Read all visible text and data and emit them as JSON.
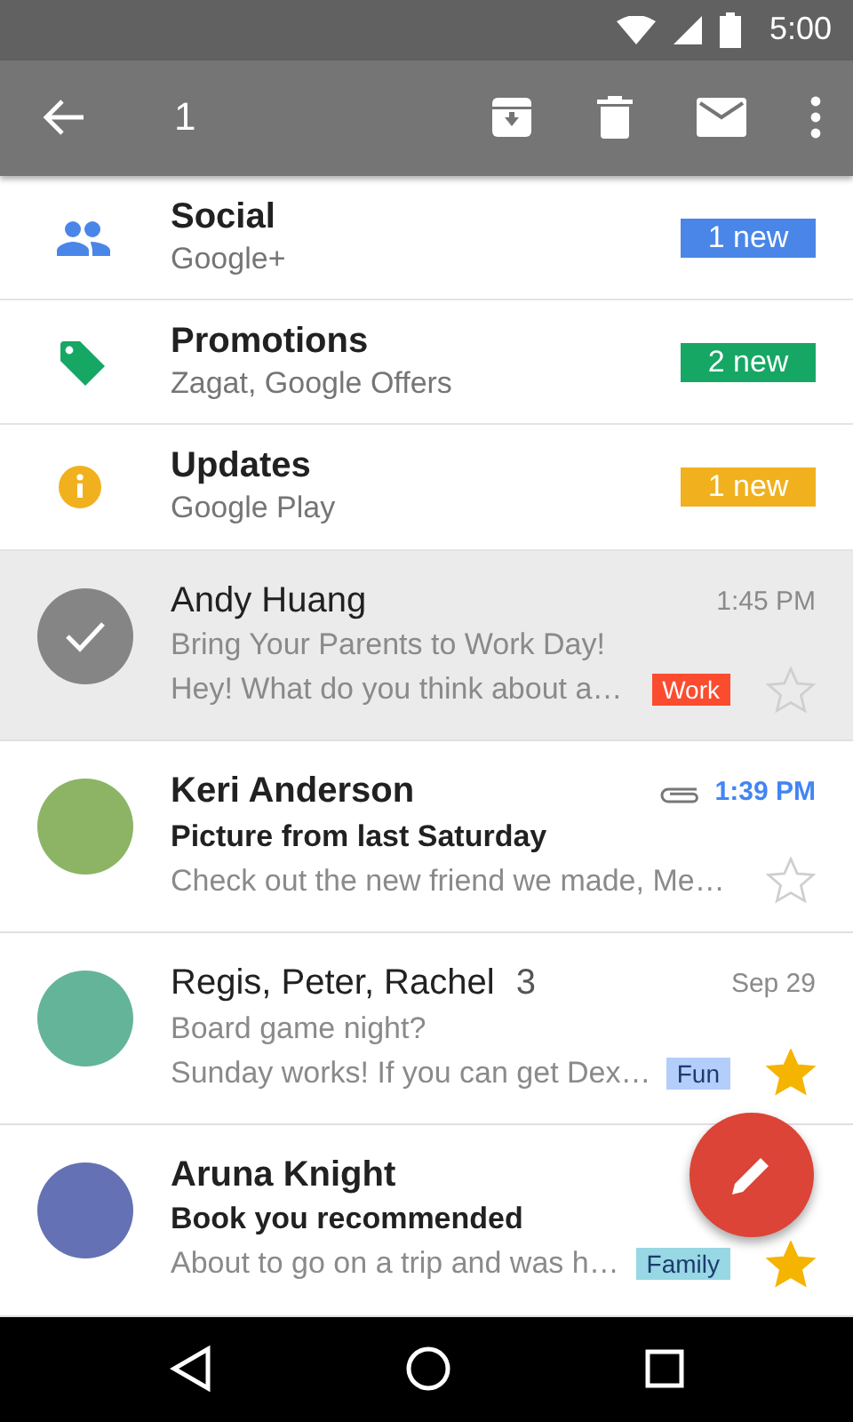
{
  "status_bar": {
    "time": "5:00"
  },
  "toolbar": {
    "selected_count": "1"
  },
  "categories": [
    {
      "kind": "social",
      "name": "Social",
      "senders": "Google+",
      "badge": "1 new",
      "color": "#4a86e8"
    },
    {
      "kind": "promotions",
      "name": "Promotions",
      "senders": "Zagat, Google Offers",
      "badge": "2 new",
      "color": "#16a765"
    },
    {
      "kind": "updates",
      "name": "Updates",
      "senders": "Google Play",
      "badge": "1 new",
      "color": "#f1b11e"
    }
  ],
  "emails": [
    {
      "sender": "Andy Huang",
      "time": "1:45 PM",
      "subject": "Bring Your Parents to Work Day!",
      "snippet": "Hey! What do you think about a…",
      "label": {
        "text": "Work",
        "color": "#fb4c2f"
      },
      "starred": false,
      "unread": false,
      "selected": true,
      "attachment": false
    },
    {
      "sender": "Keri Anderson",
      "time": "1:39 PM",
      "subject": "Picture from last Saturday",
      "snippet": "Check out the new friend we made, Me…",
      "starred": false,
      "unread": true,
      "selected": false,
      "attachment": true
    },
    {
      "sender": "Regis, Peter, Rachel",
      "count": "3",
      "time": "Sep 29",
      "subject": "Board game night?",
      "snippet": "Sunday works! If you can get Dex…",
      "label": {
        "text": "Fun",
        "color": "#b3cefb"
      },
      "starred": true,
      "unread": false,
      "selected": false,
      "attachment": false
    },
    {
      "sender": "Aruna Knight",
      "subject": "Book you recommended",
      "snippet": "About to go on a trip and was h…",
      "label": {
        "text": "Family",
        "color": "#98d7e4"
      },
      "starred": true,
      "unread": true,
      "selected": false,
      "attachment": false
    }
  ]
}
